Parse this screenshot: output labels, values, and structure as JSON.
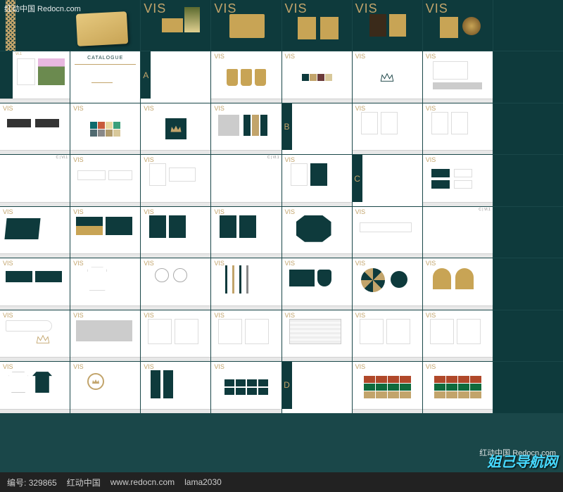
{
  "watermarks": {
    "top_left": "红动中国 Redocn.com",
    "bottom_right": "红动中国 Redocn.com",
    "nav": "姐己导航网"
  },
  "footer": {
    "id_label": "编号:",
    "id_value": "329865",
    "site": "红动中国",
    "url": "www.redocn.com",
    "author": "lama2030"
  },
  "labels": {
    "vis": "VIS",
    "catalogue": "CATALOGUE",
    "A": "A",
    "B": "B",
    "C": "C",
    "D": "D"
  },
  "meta_small": "C | VI.1"
}
